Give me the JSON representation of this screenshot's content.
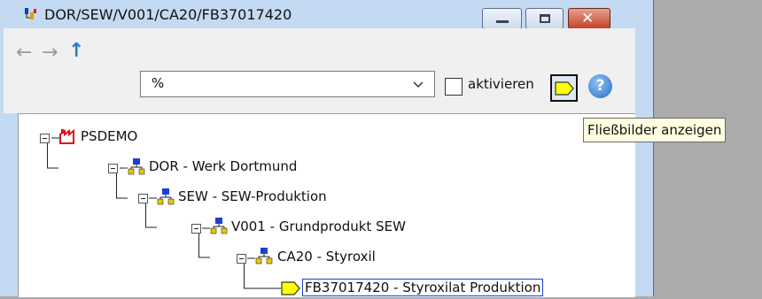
{
  "window": {
    "title": "DOR/SEW/V001/CA20/FB37017420",
    "icons": {
      "app": "process-app-icon",
      "minimize": "minimize-icon",
      "maximize": "maximize-icon",
      "close": "close-icon"
    }
  },
  "toolbar": {
    "back_icon": "arrow-left-icon",
    "forward_icon": "arrow-right-icon",
    "up_icon": "arrow-up-icon",
    "filter_value": "%",
    "activate_label": "aktivieren",
    "activate_checked": false,
    "flow_icon": "flowchart-icon",
    "help_label": "?"
  },
  "tooltip": {
    "text": "Fließbilder anzeigen"
  },
  "tree": {
    "nodes": [
      {
        "label": "PSDEMO",
        "icon": "factory-icon",
        "expanded": true,
        "selected": false
      },
      {
        "label": "DOR - Werk Dortmund",
        "icon": "hierarchy-icon",
        "expanded": true,
        "selected": false
      },
      {
        "label": "SEW - SEW-Produktion",
        "icon": "hierarchy-icon",
        "expanded": true,
        "selected": false
      },
      {
        "label": "V001 - Grundprodukt SEW",
        "icon": "hierarchy-icon",
        "expanded": true,
        "selected": false
      },
      {
        "label": "CA20 - Styroxil",
        "icon": "hierarchy-icon",
        "expanded": true,
        "selected": false
      },
      {
        "label": "FB37017420 - Styroxilat Produktion",
        "icon": "flowchart-icon",
        "expanded": false,
        "selected": true
      }
    ]
  },
  "colors": {
    "titlebar": "#c3daf2",
    "selection_border": "#1a3fd0",
    "tooltip_bg": "#fffee0",
    "close_button": "#c3442a"
  }
}
